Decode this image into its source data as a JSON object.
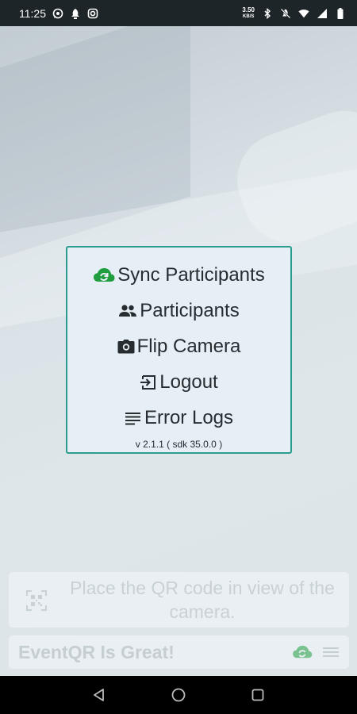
{
  "status_bar": {
    "time": "11:25",
    "net_speed_value": "3.50",
    "net_speed_unit": "KB/S",
    "left_icons": [
      "whatsapp-icon",
      "notification-icon",
      "instagram-icon"
    ],
    "right_icons": [
      "bluetooth-icon",
      "do-not-disturb-icon",
      "wifi-icon",
      "signal-icon",
      "battery-icon"
    ]
  },
  "menu": {
    "items": [
      {
        "label": "Sync Participants",
        "icon": "cloud-sync-icon",
        "icon_color": "#1f9d3f"
      },
      {
        "label": "Participants",
        "icon": "people-icon"
      },
      {
        "label": "Flip Camera",
        "icon": "camera-icon"
      },
      {
        "label": "Logout",
        "icon": "logout-icon"
      },
      {
        "label": "Error Logs",
        "icon": "list-icon"
      }
    ],
    "version": "v 2.1.1 ( sdk 35.0.0 )",
    "border_color": "#2a9d8f"
  },
  "scan_hint": {
    "text": "Place the QR code in view of the camera."
  },
  "bottom_bar": {
    "app_name": "EventQR Is Great!",
    "sync_icon_color": "#1f9d3f"
  },
  "nav_bar": {
    "buttons": [
      "back-icon",
      "home-icon",
      "recents-icon"
    ]
  }
}
